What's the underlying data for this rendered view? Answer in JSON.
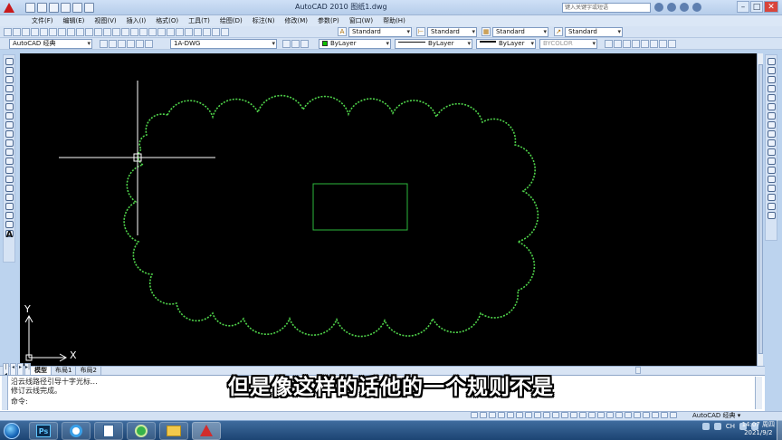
{
  "window": {
    "title": "AutoCAD 2010    图纸1.dwg",
    "search_placeholder": "键入关键字或短语"
  },
  "menu": {
    "items": [
      "文件(F)",
      "编辑(E)",
      "视图(V)",
      "插入(I)",
      "格式(O)",
      "工具(T)",
      "绘图(D)",
      "标注(N)",
      "修改(M)",
      "参数(P)",
      "窗口(W)",
      "帮助(H)"
    ]
  },
  "toolbar": {
    "text_style": "Standard",
    "dim_style": "Standard",
    "table_style": "Standard",
    "multileader_style": "Standard",
    "workspace": "AutoCAD 经典",
    "layer": "1A-DWG",
    "color": "ByLayer",
    "linetype": "ByLayer",
    "lineweight": "ByLayer",
    "plotstyle": "BYCOLOR"
  },
  "left_toolbar": {
    "text_tool": "A"
  },
  "drawing": {
    "ucs_x_label": "X",
    "ucs_y_label": "Y",
    "cloud_color": "#4fd34a",
    "rect_color": "#2db83d",
    "cursor_color": "#ffffff"
  },
  "tabs": {
    "nav": [
      "|◂",
      "◂",
      "▸",
      "▸|"
    ],
    "items": [
      "模型",
      "布局1",
      "布局2"
    ]
  },
  "command": {
    "lines": [
      "沿云线路径引导十字光标...",
      "修订云线完成。",
      "命令:"
    ]
  },
  "subtitle": "但是像这样的话他的一个规则不是",
  "statusbar": {
    "workspace_switch": "AutoCAD 经典 ▾"
  },
  "taskbar": {
    "apps": [
      "Ps",
      "",
      "",
      "",
      "",
      ""
    ],
    "language": "CH",
    "time": "14:07 周四",
    "date": "2021/9/2"
  }
}
